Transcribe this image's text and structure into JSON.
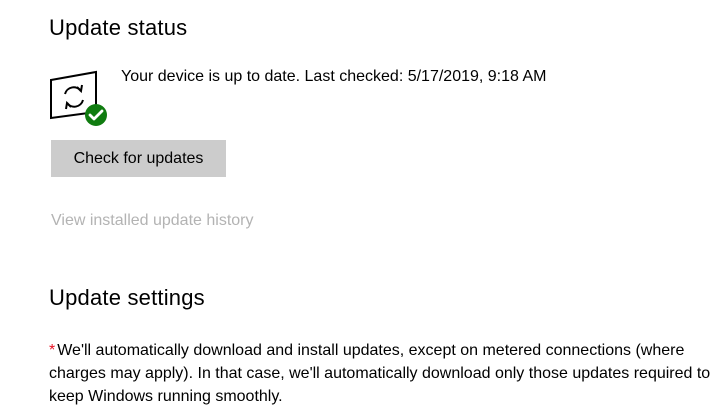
{
  "update_status": {
    "heading": "Update status",
    "icon": "update-device-icon",
    "status_message": "Your device is up to date. Last checked: 5/17/2019, 9:18 AM",
    "check_button_label": "Check for updates",
    "history_link_label": "View installed update history"
  },
  "update_settings": {
    "heading": "Update settings",
    "required_marker": "*",
    "description": "We'll automatically download and install updates, except on metered connections (where charges may apply). In that case, we'll automatically download only those updates required to keep Windows running smoothly."
  },
  "colors": {
    "button_bg": "#cccccc",
    "disabled_link": "#b3b3b3",
    "check_badge": "#107c10",
    "asterisk": "#e81123"
  }
}
